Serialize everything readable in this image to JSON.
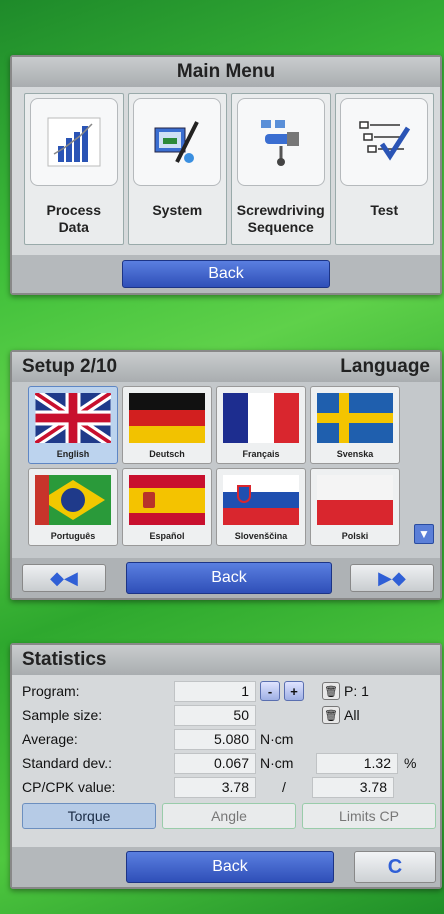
{
  "main_menu": {
    "title": "Main Menu",
    "items": [
      {
        "label_line1": "Process",
        "label_line2": "Data",
        "icon": "chart-icon"
      },
      {
        "label_line1": "System",
        "label_line2": "",
        "icon": "system-icon"
      },
      {
        "label_line1": "Screwdriving",
        "label_line2": "Sequence",
        "icon": "sequence-icon"
      },
      {
        "label_line1": "Test",
        "label_line2": "",
        "icon": "checklist-icon"
      }
    ],
    "back_label": "Back"
  },
  "setup": {
    "title": "Setup 2/10",
    "section": "Language",
    "languages": [
      {
        "label": "English",
        "flag": "uk"
      },
      {
        "label": "Deutsch",
        "flag": "de"
      },
      {
        "label": "Français",
        "flag": "fr"
      },
      {
        "label": "Svenska",
        "flag": "se"
      },
      {
        "label": "Português",
        "flag": "br"
      },
      {
        "label": "Español",
        "flag": "es"
      },
      {
        "label": "Slovenščina",
        "flag": "si"
      },
      {
        "label": "Polski",
        "flag": "pl"
      }
    ],
    "selected": "English",
    "back_label": "Back"
  },
  "statistics": {
    "title": "Statistics",
    "program_label": "Program:",
    "program_value": "1",
    "minus": "-",
    "plus": "+",
    "program_ref": "P: 1",
    "sample_label": "Sample size:",
    "sample_value": "50",
    "sample_ref": "All",
    "average_label": "Average:",
    "average_value": "5.080",
    "average_unit": "N·cm",
    "stddev_label": "Standard dev.:",
    "stddev_value": "0.067",
    "stddev_unit": "N·cm",
    "stddev_pct": "1.32",
    "pct_sign": "%",
    "cp_label": "CP/CPK value:",
    "cp_value": "3.78",
    "cp_sep": "/",
    "cpk_value": "3.78",
    "tabs": [
      "Torque",
      "Angle",
      "Limits CP"
    ],
    "active_tab": "Torque",
    "back_label": "Back",
    "reset_glyph": "C"
  }
}
